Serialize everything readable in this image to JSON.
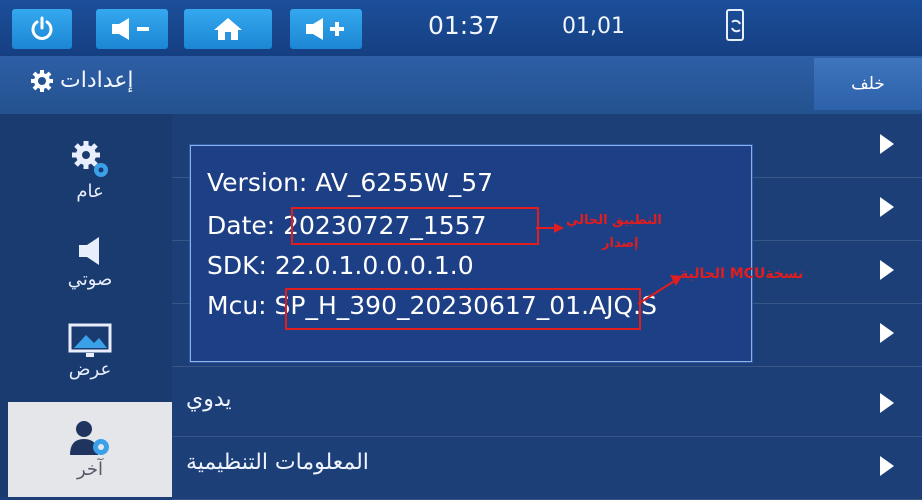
{
  "statusbar": {
    "time": "01:37",
    "date": "01,01"
  },
  "header": {
    "title": "إعدادات",
    "back_label": "خلف"
  },
  "sidebar": {
    "items": [
      {
        "label": "عام",
        "icon": "gears-icon"
      },
      {
        "label": "صوتي",
        "icon": "speaker-icon"
      },
      {
        "label": "عرض",
        "icon": "display-icon"
      },
      {
        "label": "آخر",
        "icon": "person-gear-icon"
      }
    ]
  },
  "menu": {
    "rows": [
      "يدوي",
      "المعلومات التنظيمية"
    ]
  },
  "dialog": {
    "version_line": "Version: AV_6255W_57",
    "date_prefix": "Date: ",
    "date_value": "20230727_1557",
    "sdk_line": "SDK: 22.0.1.0.0.0.1.0",
    "mcu_prefix": "Mcu: ",
    "mcu_value": "SP_H_390_20230617_01",
    "mcu_suffix": ".AJQ.S"
  },
  "annotations": {
    "app_note_1": "التطبيق الحالي",
    "app_note_2": "إصدار",
    "mcu_note": "الحالية MCUنسخة"
  },
  "colors": {
    "accent": "#2a9ae6",
    "annotation": "#e21d1d"
  }
}
